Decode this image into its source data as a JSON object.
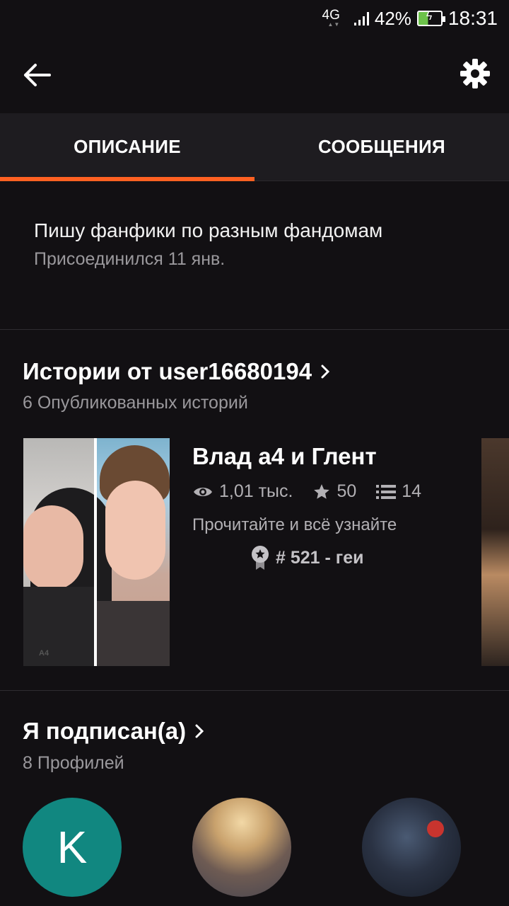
{
  "status_bar": {
    "network": "4G",
    "battery": "42%",
    "time": "18:31"
  },
  "tabs": [
    {
      "label": "ОПИСАНИЕ",
      "active": true
    },
    {
      "label": "СООБЩЕНИЯ",
      "active": false
    }
  ],
  "about": {
    "bio": "Пишу фанфики по разным фандомам",
    "joined": "Присоединился 11 янв."
  },
  "stories": {
    "title": "Истории от user16680194",
    "subtitle": "6 Опубликованных историй",
    "items": [
      {
        "title": "Влад а4 и Глент",
        "reads": "1,01 тыс.",
        "votes": "50",
        "parts": "14",
        "description": "Прочитайте и всё узнайте",
        "rank": "# 521 - геи",
        "cover_text": "A4"
      }
    ]
  },
  "following": {
    "title": "Я подписан(а)",
    "subtitle": "8 Профилей",
    "avatars": [
      {
        "initial": "K",
        "color": "#118780"
      },
      {
        "initial": ""
      },
      {
        "initial": ""
      }
    ]
  },
  "colors": {
    "accent": "#ff6122",
    "background": "#121013",
    "tab_bar": "#1e1c20"
  }
}
